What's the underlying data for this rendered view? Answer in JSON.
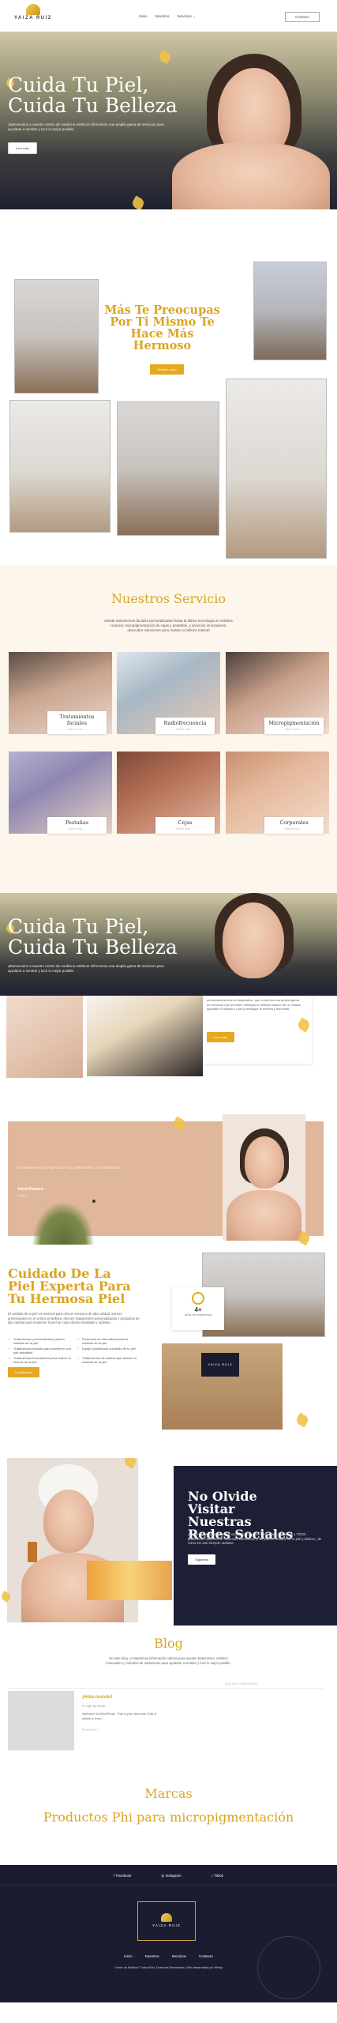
{
  "header": {
    "logo_text": "YAIZA RUIZ",
    "nav": [
      "Inicio",
      "Nosotros",
      "Servicios"
    ],
    "cta": "Contacto"
  },
  "hero": {
    "title_line1": "Cuida Tu Piel,",
    "title_line2": "Cuida Tu Belleza",
    "text": "¡Bienvenidos a nuestro centro de medicina estética! Ofrecemos una amplia gama de servicios para ayudarte a sentirte y lucir lo mejor posible.",
    "button": "Leer más"
  },
  "preocupas": {
    "title": "Más Te Preocupas Por Ti Mismo Te Hace Más Hermoso",
    "button": "Sentirte mejor"
  },
  "servicios": {
    "title": "Nuestros Servicio",
    "intro": "Desde tratamientos faciales personalizados hasta la última tecnología en estética corporal, micropigmentación de cejas y pestañas, y servicios innovadores, ¡descubre soluciones para realzar tu belleza natural!",
    "cards": [
      {
        "label": "Tratamientos faciales",
        "more": "Saber más →"
      },
      {
        "label": "Radiofrecuencia",
        "more": "Saber más →"
      },
      {
        "label": "Micropigmentación",
        "more": "Saber más →"
      },
      {
        "label": "Pestañas",
        "more": "Saber más →"
      },
      {
        "label": "Cejas",
        "more": "Saber más →"
      },
      {
        "label": "Corporales",
        "more": "Saber más →"
      }
    ]
  },
  "hero2": {
    "title_line1": "Cuida Tu Piel,",
    "title_line2": "Cuida Tu Belleza",
    "text": "¡Bienvenidos a nuestro centro de medicina estética! Ofrecemos una amplia gama de servicios para ayudarte a sentirte y lucir lo mejor posible."
  },
  "about": {
    "text": "personalizada tras tu diagnóstico, que conforma una amplia gama de servicios que permiten enfatizar tu belleza natural, de un vistazo ayudarte tu estado tu piel y destaque tu belleza y bienestar.",
    "button": "Leer más"
  },
  "testimonial": {
    "quote": "Excelente servicio y atención, muy profesionales, ¡lo recomiendo!",
    "author": "Yaiza Romero",
    "role": "Cliente"
  },
  "experta": {
    "title": "Cuidado De La Piel Experta Para Tu Hermosa Piel",
    "text": "El cuidado de la piel es esencial para ofrecer servicios de alta calidad. Somos profesionales en el centro de belleza, ofrecen tratamientos personalizados y productos de alta calidad para mantener la piel de cada cliente saludable y radiante.",
    "features": [
      "Tratamientos personalizados para el cuidado de tu piel",
      "Productos de alta calidad para el cuidado de la piel",
      "Tratamientos faciales para mantener una piel saludable",
      "Equipo profesional cuidando de tu piel",
      "Tratamientos innovadores para reducir la textura de la piel",
      "Tratamientos de belleza que afecten el cuidado de tu piel"
    ],
    "badge_number": "4+",
    "badge_label": "Años de experiencia",
    "button": "Contáctanos"
  },
  "redes": {
    "title": "No Olvide Visitar Nuestras Redes Sociales",
    "text": "¡Síguenos en nuestras redes sociales! En nuestro Instagram, Facebook y TikTok publicamos diariamente contenido interesante y útil para el cuidado de tu piel y belleza, ¡de cómo ser aun siempre radiante.",
    "button": "Síguenos"
  },
  "blog": {
    "title": "Blog",
    "intro": "En este blog, compartimos información valiosa para nuestro tratamiento, estética innovadora y métodos de tratamiento para ayudarte a sentirte y lucir lo mejor posible.",
    "post": {
      "date": "AÚN SIN COMENTARIOS",
      "title": "¡Hola mundo!",
      "meta": "Login by anulat",
      "excerpt": "Welcome to WordPress. This is your first post. Edit or delete it, then...",
      "more": "Read More →"
    }
  },
  "marcas": {
    "title": "Marcas",
    "subtitle": "Productos Phi para micropigmentación"
  },
  "footer": {
    "social": [
      "Facebook",
      "Instagram",
      "Tiktok"
    ],
    "logo_text": "YAIZA RUIZ",
    "nav": [
      "Inicio",
      "Nosotros",
      "Servicios",
      "Contacto"
    ],
    "legal": "Centro de Estética © Yaiza Ruiz. Derechos Reservados | Sitio desarrollado por Writop"
  },
  "colors": {
    "accent": "#e5a81e",
    "heading_gold": "#d9a521",
    "dark_navy": "#1b1c30",
    "cream": "#fdf6ec"
  }
}
